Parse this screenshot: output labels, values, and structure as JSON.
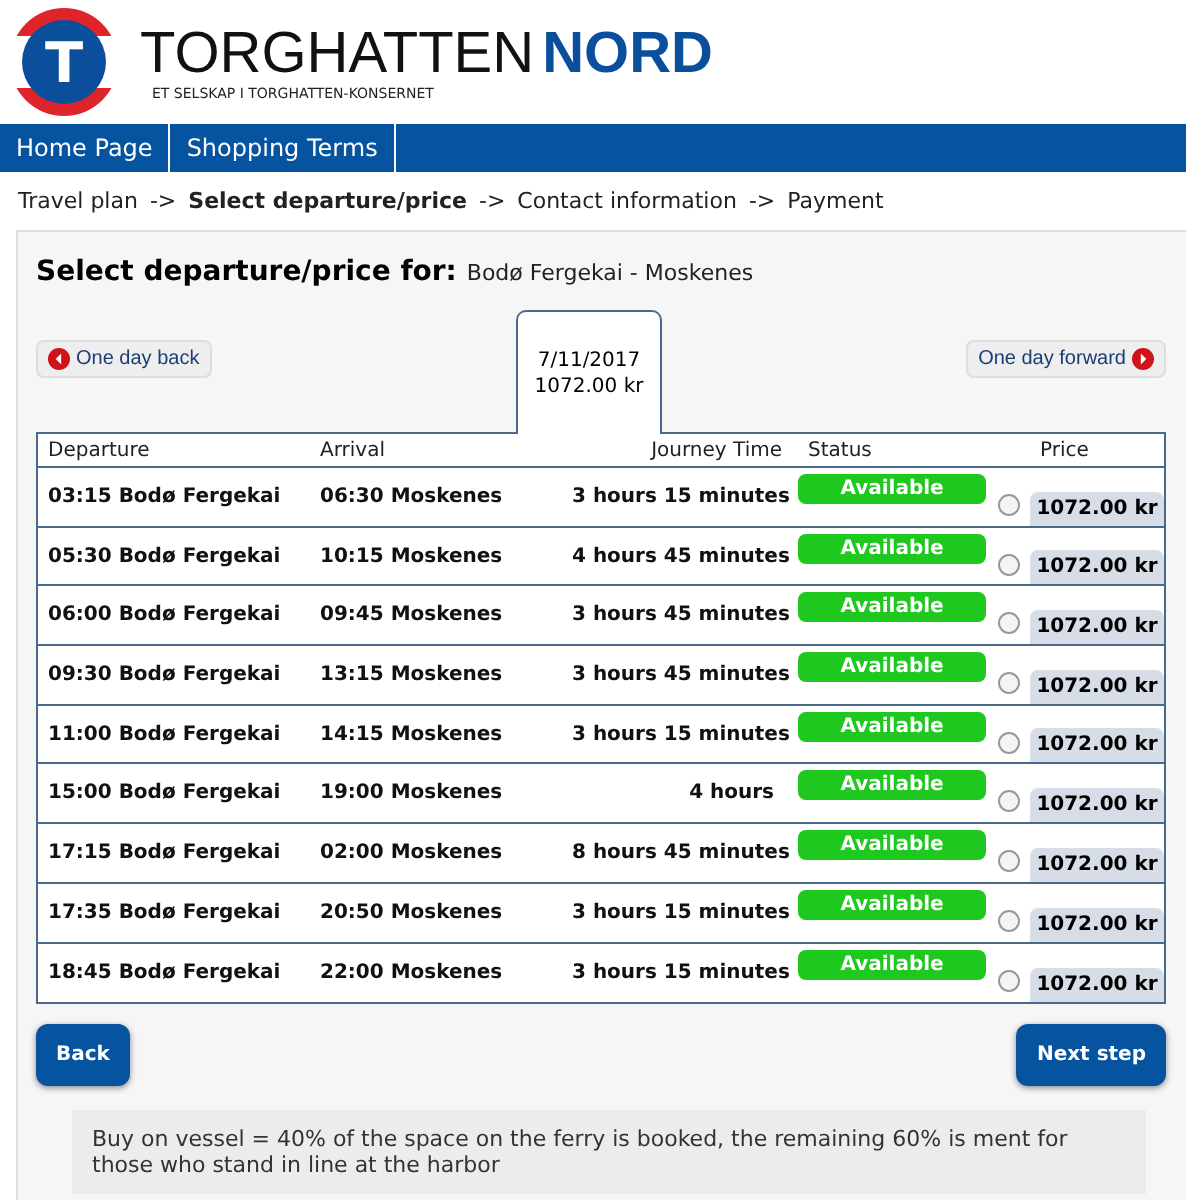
{
  "logo": {
    "letter": "T",
    "name": "TORGHATTEN",
    "name_accent": "NORD",
    "tagline": "ET SELSKAP I TORGHATTEN-KONSERNET"
  },
  "nav": [
    "Home Page",
    "Shopping Terms"
  ],
  "breadcrumb": [
    {
      "label": "Travel plan",
      "selected": false
    },
    {
      "label": "Select departure/price",
      "selected": true
    },
    {
      "label": "Contact information",
      "selected": false
    },
    {
      "label": "Payment",
      "selected": false
    }
  ],
  "breadcrumb_separator": "->",
  "heading": {
    "title": "Select departure/price for:",
    "route": "Bodø Fergekai - Moskenes"
  },
  "day_back": "One day back",
  "day_forward": "One day forward",
  "date_tab": {
    "date": "7/11/2017",
    "price": "1072.00 kr"
  },
  "columns": [
    "Departure",
    "Arrival",
    "Journey Time",
    "Status",
    "Price"
  ],
  "rows": [
    {
      "departure": "03:15 Bodø Fergekai",
      "arrival": "06:30 Moskenes",
      "time": "3 hours 15 minutes",
      "status": "Available",
      "price": "1072.00 kr",
      "selected": false
    },
    {
      "departure": "05:30 Bodø Fergekai",
      "arrival": "10:15 Moskenes",
      "time": "4 hours 45 minutes",
      "status": "Available",
      "price": "1072.00 kr",
      "selected": false
    },
    {
      "departure": "06:00 Bodø Fergekai",
      "arrival": "09:45 Moskenes",
      "time": "3 hours 45 minutes",
      "status": "Available",
      "price": "1072.00 kr",
      "selected": false
    },
    {
      "departure": "09:30 Bodø Fergekai",
      "arrival": "13:15 Moskenes",
      "time": "3 hours 45 minutes",
      "status": "Available",
      "price": "1072.00 kr",
      "selected": false
    },
    {
      "departure": "11:00 Bodø Fergekai",
      "arrival": "14:15 Moskenes",
      "time": "3 hours 15 minutes",
      "status": "Available",
      "price": "1072.00 kr",
      "selected": false
    },
    {
      "departure": "15:00 Bodø Fergekai",
      "arrival": "19:00 Moskenes",
      "time": "4 hours",
      "status": "Available",
      "price": "1072.00 kr",
      "selected": false
    },
    {
      "departure": "17:15 Bodø Fergekai",
      "arrival": "02:00 Moskenes",
      "time": "8 hours 45 minutes",
      "status": "Available",
      "price": "1072.00 kr",
      "selected": false
    },
    {
      "departure": "17:35 Bodø Fergekai",
      "arrival": "20:50 Moskenes",
      "time": "3 hours 15 minutes",
      "status": "Available",
      "price": "1072.00 kr",
      "selected": false
    },
    {
      "departure": "18:45 Bodø Fergekai",
      "arrival": "22:00 Moskenes",
      "time": "3 hours 15 minutes",
      "status": "Available",
      "price": "1072.00 kr",
      "selected": false
    }
  ],
  "back": "Back",
  "next": "Next step",
  "note": "Buy on vessel = 40% of the space on the ferry is booked, the remaining 60% is ment for those who stand in line at the harbor"
}
